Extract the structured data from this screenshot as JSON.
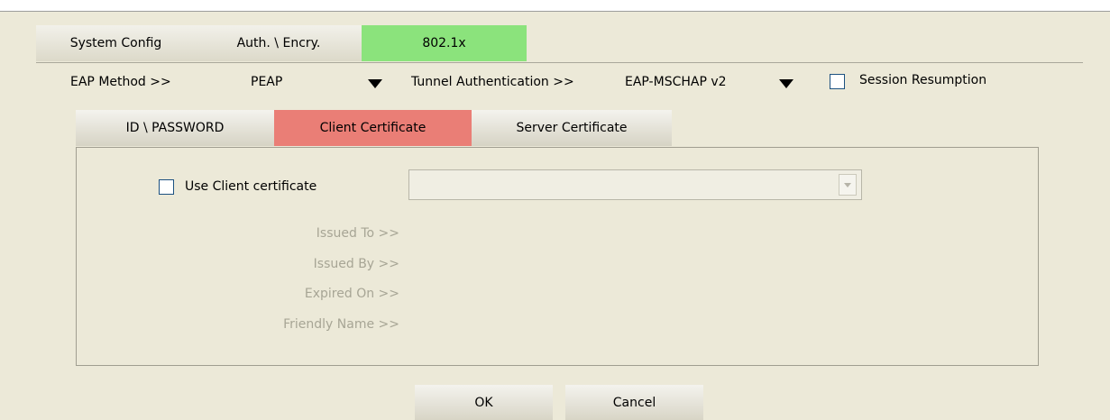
{
  "main_tabs": [
    {
      "label": "System Config"
    },
    {
      "label": "Auth. \\ Encry."
    },
    {
      "label": "802.1x",
      "active": true
    }
  ],
  "eap": {
    "method_label": "EAP Method >>",
    "method_value": "PEAP",
    "tunnel_label": "Tunnel Authentication >>",
    "tunnel_value": "EAP-MSCHAP v2",
    "session_label": "Session Resumption",
    "session_checked": false
  },
  "sub_tabs": [
    {
      "label": "ID \\ PASSWORD"
    },
    {
      "label": "Client Certificate",
      "active": true
    },
    {
      "label": "Server Certificate"
    }
  ],
  "client_cert": {
    "use_label": "Use Client certificate",
    "use_checked": false,
    "select_value": "",
    "fields": [
      {
        "label": "Issued To >>"
      },
      {
        "label": "Issued By >>"
      },
      {
        "label": "Expired On >>"
      },
      {
        "label": "Friendly Name >>"
      }
    ]
  },
  "buttons": {
    "ok": "OK",
    "cancel": "Cancel"
  },
  "colors": {
    "background": "#ECE9D8",
    "active_main_tab": "#8be37c",
    "active_sub_tab": "#ea7e76",
    "disabled_text": "#a7a595"
  },
  "icons": {
    "eap_method_dropdown": "triangle-down-icon",
    "tunnel_dropdown": "triangle-down-icon",
    "cert_select_dropdown": "chevron-down-icon"
  }
}
